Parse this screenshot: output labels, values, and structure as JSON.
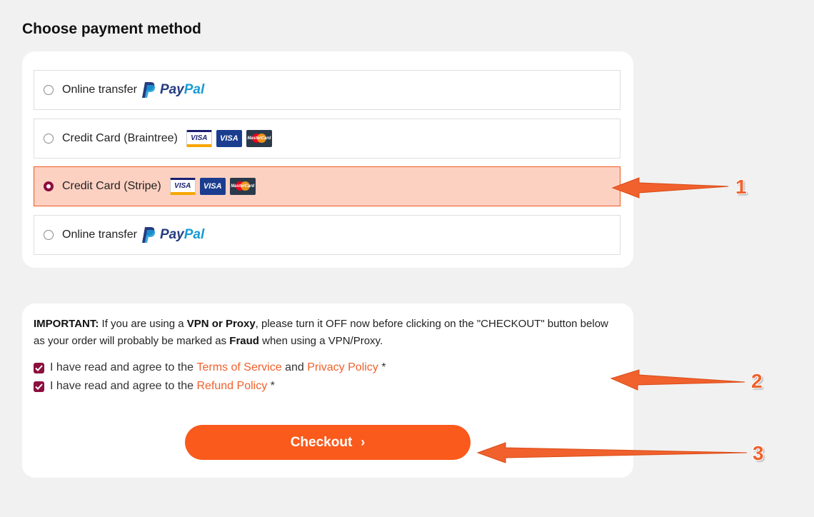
{
  "page": {
    "title": "Choose payment method"
  },
  "payment_options": [
    {
      "label": "Online transfer",
      "brand": "PayPal",
      "brand_pay": "Pay",
      "brand_pal": "Pal",
      "selected": false
    },
    {
      "label": "Credit Card (Braintree)",
      "cards": [
        "Visa Electron",
        "Visa",
        "MasterCard"
      ],
      "selected": false
    },
    {
      "label": "Credit Card (Stripe)",
      "cards": [
        "Visa Electron",
        "Visa",
        "MasterCard"
      ],
      "selected": true
    },
    {
      "label": "Online transfer",
      "brand": "PayPal",
      "brand_pay": "Pay",
      "brand_pal": "Pal",
      "selected": false
    }
  ],
  "card_text": {
    "visa": "VISA",
    "mastercard": "MasterCard"
  },
  "notice": {
    "important": "IMPORTANT:",
    "part1": " If you are using a ",
    "vpn": "VPN or Proxy",
    "part2": ", please turn it OFF now before clicking on the \"CHECKOUT\" button below as your order will probably be marked as ",
    "fraud": "Fraud",
    "part3": " when using a VPN/Proxy."
  },
  "agreements": {
    "terms": {
      "prefix": "I have read and agree to the ",
      "link1": "Terms of Service",
      "middle": " and ",
      "link2": "Privacy Policy",
      "suffix": " *",
      "checked": true
    },
    "refund": {
      "prefix": "I have read and agree to the ",
      "link1": "Refund Policy",
      "suffix": " *",
      "checked": true
    }
  },
  "checkout": {
    "label": "Checkout",
    "chevron": "›"
  },
  "annotations": {
    "one": "1",
    "two": "2",
    "three": "3"
  },
  "colors": {
    "accent": "#fa5a1c",
    "selected_bg": "#fdd1c2",
    "checkbox": "#8c0f3e",
    "link": "#f0612d"
  }
}
